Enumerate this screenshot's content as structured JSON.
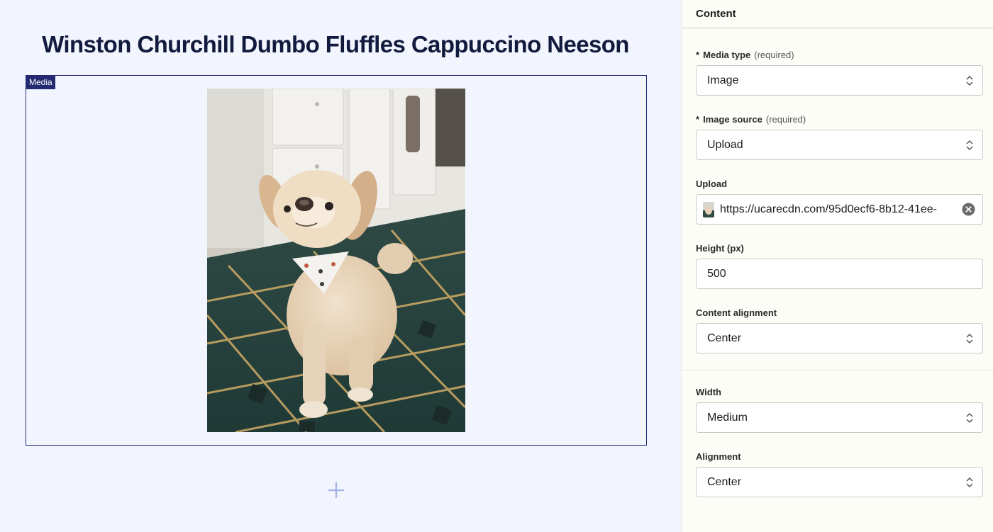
{
  "canvas": {
    "title": "Winston Churchill Dumbo Fluffles Cappuccino Neeson",
    "media_tag": "Media",
    "add_icon": "plus-icon"
  },
  "panel": {
    "header": "Content",
    "media_type": {
      "label": "Media type",
      "required": "(required)",
      "value": "Image"
    },
    "image_source": {
      "label": "Image source",
      "required": "(required)",
      "value": "Upload"
    },
    "upload": {
      "label": "Upload",
      "value": "https://ucarecdn.com/95d0ecf6-8b12-41ee-",
      "clear_icon": "clear-circle-icon"
    },
    "height": {
      "label": "Height (px)",
      "value": "500"
    },
    "content_alignment": {
      "label": "Content alignment",
      "value": "Center"
    },
    "width": {
      "label": "Width",
      "value": "Medium"
    },
    "alignment": {
      "label": "Alignment",
      "value": "Center"
    },
    "required_marker": "*"
  },
  "colors": {
    "canvas_bg": "#f2f5fe",
    "accent": "#232a72",
    "panel_bg": "#fdfdf8"
  }
}
